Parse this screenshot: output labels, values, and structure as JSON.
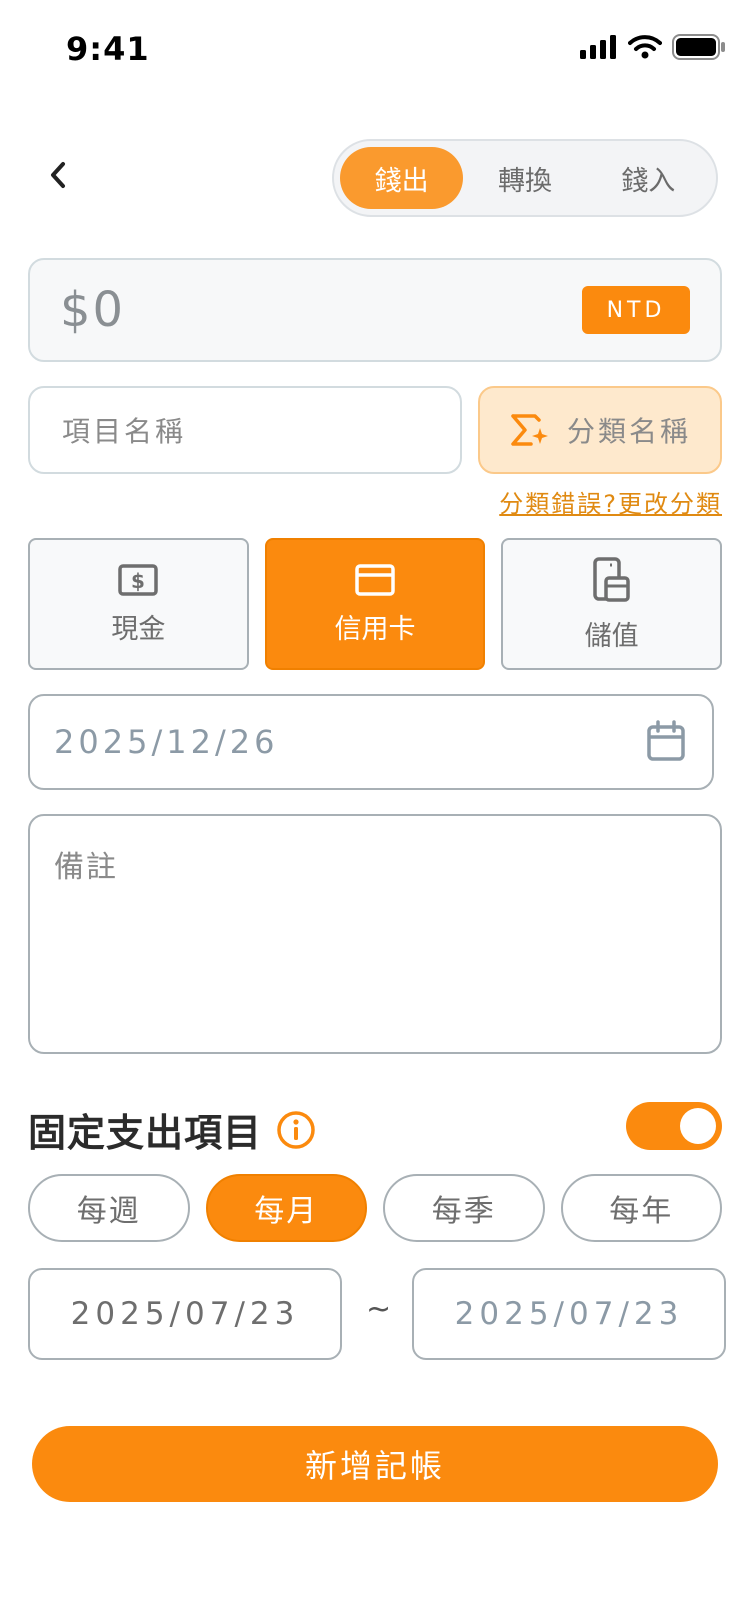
{
  "status_bar": {
    "time": "9:41"
  },
  "tabs": [
    {
      "label": "錢出",
      "active": true
    },
    {
      "label": "轉換",
      "active": false
    },
    {
      "label": "錢入",
      "active": false
    }
  ],
  "amount": {
    "value": "$0",
    "currency": "NTD"
  },
  "item_name": {
    "placeholder": "項目名稱"
  },
  "category": {
    "label": "分類名稱",
    "fix_link": "分類錯誤?更改分類"
  },
  "payment_methods": [
    {
      "label": "現金",
      "icon": "cash-icon",
      "active": false
    },
    {
      "label": "信用卡",
      "icon": "credit-card-icon",
      "active": true
    },
    {
      "label": "儲值",
      "icon": "stored-value-icon",
      "active": false
    }
  ],
  "date": {
    "value": "2025/12/26"
  },
  "memo": {
    "placeholder": "備註"
  },
  "fixed_expense": {
    "title": "固定支出項目",
    "enabled": true
  },
  "frequencies": [
    {
      "label": "每週",
      "active": false
    },
    {
      "label": "每月",
      "active": true
    },
    {
      "label": "每季",
      "active": false
    },
    {
      "label": "每年",
      "active": false
    }
  ],
  "range": {
    "start": "2025/07/23",
    "separator": "~",
    "end": "2025/07/23"
  },
  "submit_label": "新增記帳",
  "colors": {
    "accent": "#fb8a0e",
    "accent_light": "#fee9cd",
    "border": "#a8b0b5"
  }
}
